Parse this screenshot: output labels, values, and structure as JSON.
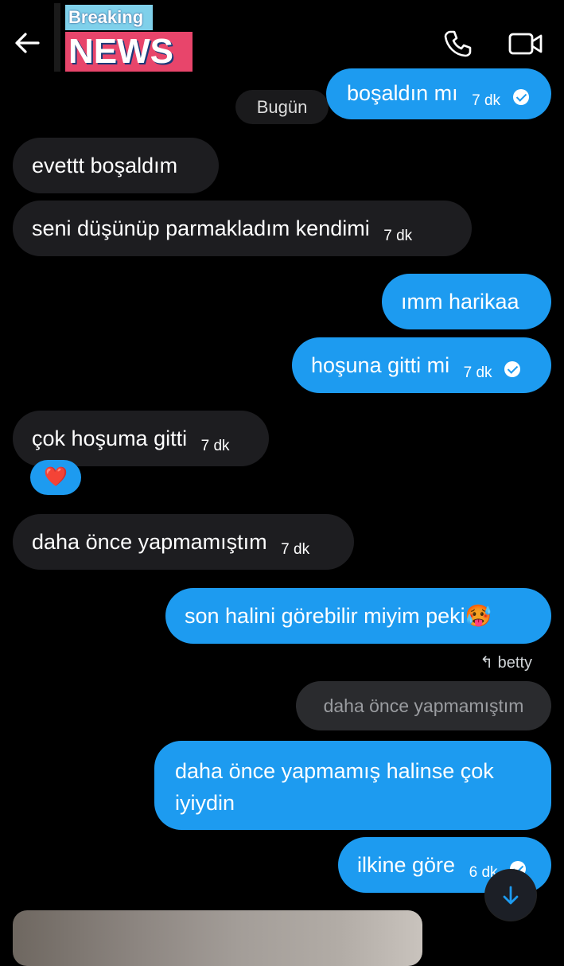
{
  "logo": {
    "line1": "Breaking",
    "line2": "NEWS"
  },
  "header": {
    "back_icon": "arrow-left-icon",
    "call_icon": "phone-icon",
    "video_icon": "video-camera-icon"
  },
  "date_separator": "Bugün",
  "messages": [
    {
      "side": "out",
      "text": "boşaldın mı",
      "time": "7 dk",
      "read": true
    },
    {
      "side": "in",
      "text": "evettt boşaldım",
      "time": ""
    },
    {
      "side": "in",
      "text": "seni düşünüp parmakladım kendimi",
      "time": "7 dk"
    },
    {
      "side": "out",
      "text": "ımm harikaa",
      "time": ""
    },
    {
      "side": "out",
      "text": "hoşuna gitti mi",
      "time": "7 dk",
      "read": true
    },
    {
      "side": "in",
      "text": "çok hoşuma gitti",
      "time": "7 dk",
      "reaction": "❤️"
    },
    {
      "side": "in",
      "text": "daha önce yapmamıştım",
      "time": "7 dk"
    },
    {
      "side": "out",
      "text": "son halini görebilir miyim peki",
      "emoji": "🥵"
    },
    {
      "side": "out",
      "reply_to_name": "betty",
      "reply_to_text": "daha önce yapmamıştım",
      "text_line1": "daha önce yapmamış halinse çok",
      "text_line2": "iyiydin"
    },
    {
      "side": "out",
      "text": "ilkine göre",
      "time": "6 dk",
      "read": true
    }
  ],
  "colors": {
    "outgoing": "#1d9bf0",
    "incoming": "#1d1d20",
    "background": "#000000"
  }
}
